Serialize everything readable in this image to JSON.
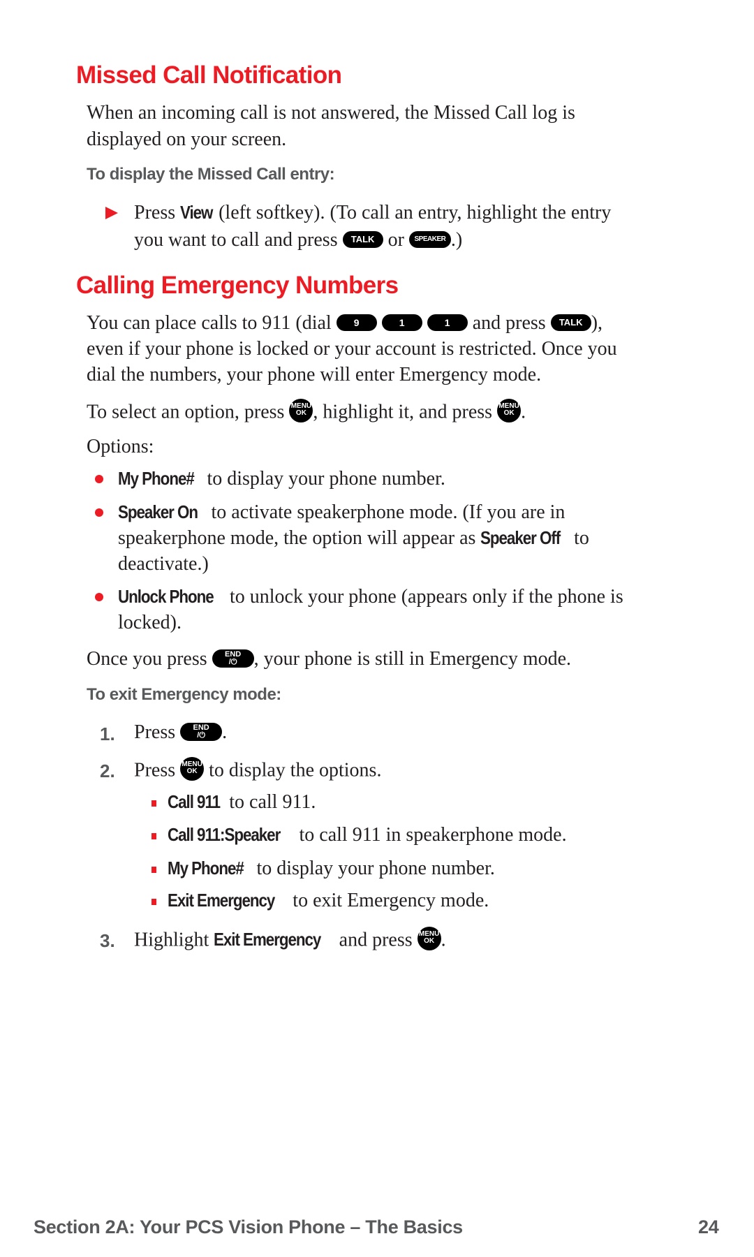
{
  "section1": {
    "title": "Missed Call Notification",
    "para_line1": "When an incoming call is not answered, the Missed Call log is",
    "para_line2": "displayed on your screen.",
    "subhead": "To display the Missed Call entry:",
    "step": {
      "t1": "Press ",
      "bold": "View",
      "t2": " (left softkey). (To call an entry, highlight the entry",
      "t3": "you want to call and press ",
      "t4": " or ",
      "t5": ".)"
    }
  },
  "section2": {
    "title": "Calling Emergency Numbers",
    "para_l1_a": "You can place calls to 911 (dial ",
    "para_l1_b": " and press ",
    "para_l1_c": "),",
    "para_line2": "even if your phone is locked or your account is restricted. Once you",
    "para_line3": "dial the numbers, your phone will enter Emergency mode.",
    "select_a": "To select an option, press ",
    "select_b": ", highlight it, and press ",
    "select_c": ".",
    "options_label": "Options:",
    "options": [
      {
        "bold": "My Phone#",
        "text": " to display your phone number."
      },
      {
        "bold": "Speaker On",
        "text": " to activate speakerphone mode. (If you are in",
        "line2_a": "speakerphone mode, the option will appear as ",
        "line2_bold": "Speaker Off",
        "line2_b": " to",
        "line3": "deactivate.)"
      },
      {
        "bold": "Unlock Phone",
        "text": " to unlock your phone (appears only if the phone is",
        "line2": "locked)."
      }
    ],
    "once_a": "Once you press ",
    "once_b": ", your phone is still in Emergency mode.",
    "exit_subhead": "To exit Emergency mode:",
    "steps": [
      {
        "num": "1.",
        "a": "Press ",
        "b": "."
      },
      {
        "num": "2.",
        "a": "Press ",
        "b": " to display the options."
      },
      {
        "num": "3.",
        "a": "Highlight ",
        "bold": "Exit Emergency",
        "b": " and press ",
        "c": "."
      }
    ],
    "sub_options": [
      {
        "bold": "Call 911",
        "text": " to call 911."
      },
      {
        "bold": "Call 911:Speaker",
        "text": " to call 911 in speakerphone mode."
      },
      {
        "bold": "My Phone#",
        "text": " to display your phone number."
      },
      {
        "bold": "Exit Emergency",
        "text": " to exit Emergency mode."
      }
    ]
  },
  "keys": {
    "talk": "TALK",
    "speaker": "SPEAKER",
    "digits": [
      "9",
      "1",
      "1"
    ],
    "menu_top": "MENU",
    "menu_bottom": "OK",
    "end_top": "END",
    "end_bottom": "/⏻"
  },
  "footer": {
    "section": "Section 2A: Your PCS Vision Phone – The Basics",
    "page": "24"
  },
  "colors": {
    "accent": "#ed1c24",
    "subhead": "#58595b",
    "text": "#231f20"
  }
}
